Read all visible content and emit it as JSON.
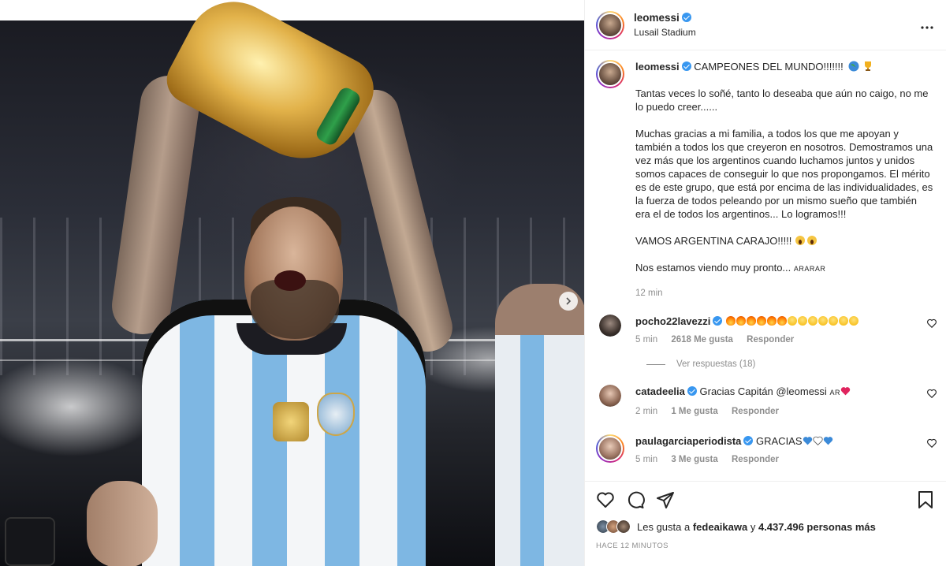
{
  "header": {
    "username": "leomessi",
    "location": "Lusail Stadium",
    "more_icon": "more-horizontal-icon"
  },
  "caption": {
    "username": "leomessi",
    "title": "CAMPEONES DEL MUNDO!!!!!!!",
    "paragraphs": [
      "Tantas veces lo soñé, tanto lo deseaba que aún no caigo, no me lo puedo creer......",
      "Muchas gracias a mi familia, a todos los que me apoyan y también a todos los que creyeron en nosotros. Demostramos una vez más que los argentinos cuando luchamos juntos y unidos somos capaces de conseguir lo que nos propongamos. El mérito es de este grupo, que está por encima de las individualidades, es la fuerza de todos peleando por un mismo sueño que también era el de todos los argentinos... Lo logramos!!!",
      "VAMOS ARGENTINA CARAJO!!!!!"
    ],
    "last_line": "Nos estamos viendo muy pronto...",
    "flag_text": "ARARAR",
    "time": "12 min"
  },
  "comments": [
    {
      "username": "pocho22lavezzi",
      "text": "",
      "time": "5 min",
      "likes": "2618 Me gusta",
      "reply": "Responder"
    },
    {
      "username": "catadeelia",
      "text": "Gracias Capitán @leomessi",
      "suffix": "AR",
      "time": "2 min",
      "likes": "1 Me gusta",
      "reply": "Responder"
    },
    {
      "username": "paulagarciaperiodista",
      "text": "GRACIAS",
      "time": "5 min",
      "likes": "3 Me gusta",
      "reply": "Responder"
    }
  ],
  "view_replies": "Ver respuestas (18)",
  "actions": {
    "likes_prefix": "Les gusta a",
    "likes_user": "fedeaikawa",
    "likes_and": "y",
    "likes_count": "4.437.496 personas más",
    "posted": "HACE 12 MINUTOS"
  },
  "colors": {
    "verified": "#3897f0",
    "muted": "#8e8e8e",
    "text": "#262626"
  }
}
